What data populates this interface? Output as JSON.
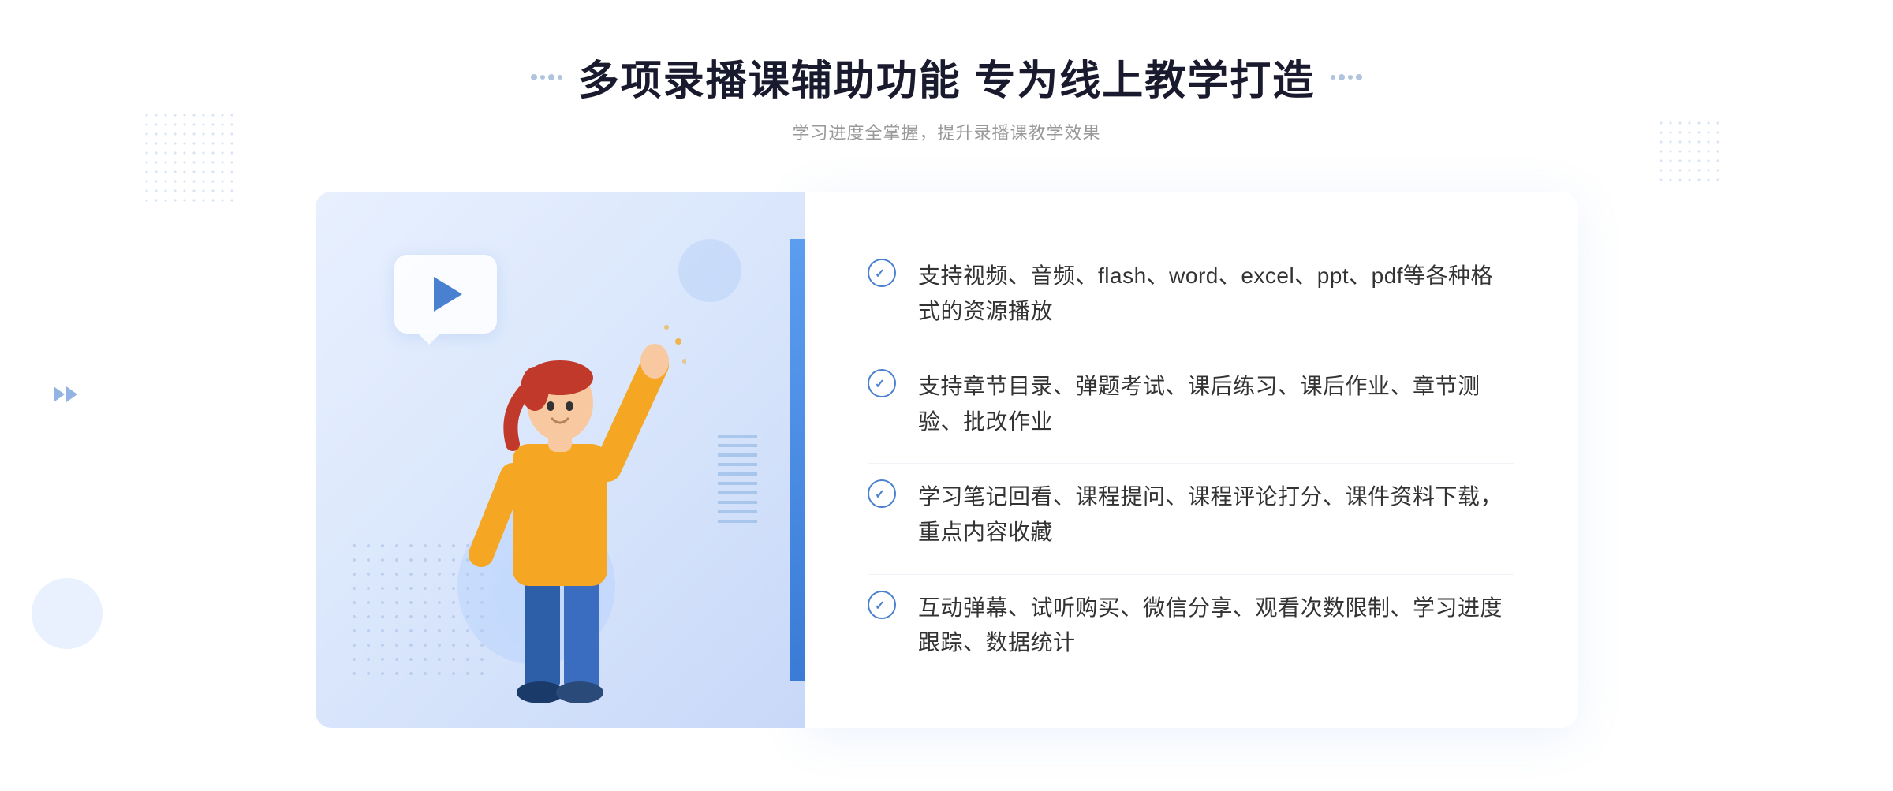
{
  "page": {
    "background": "#ffffff"
  },
  "header": {
    "title": "多项录播课辅助功能 专为线上教学打造",
    "subtitle": "学习进度全掌握，提升录播课教学效果",
    "title_left_decorator": "··",
    "title_right_decorator": "··"
  },
  "features": [
    {
      "id": 1,
      "text": "支持视频、音频、flash、word、excel、ppt、pdf等各种格式的资源播放"
    },
    {
      "id": 2,
      "text": "支持章节目录、弹题考试、课后练习、课后作业、章节测验、批改作业"
    },
    {
      "id": 3,
      "text": "学习笔记回看、课程提问、课程评论打分、课件资料下载，重点内容收藏"
    },
    {
      "id": 4,
      "text": "互动弹幕、试听购买、微信分享、观看次数限制、学习进度跟踪、数据统计"
    }
  ],
  "illustration": {
    "play_button_alt": "播放按钮",
    "image_alt": "录播课辅助功能插图"
  },
  "colors": {
    "primary": "#4a80d0",
    "text_dark": "#1a1a2e",
    "text_light": "#999999",
    "text_body": "#333333",
    "bg_illustration": "#dce8fc",
    "border_light": "#f0f4f8"
  }
}
